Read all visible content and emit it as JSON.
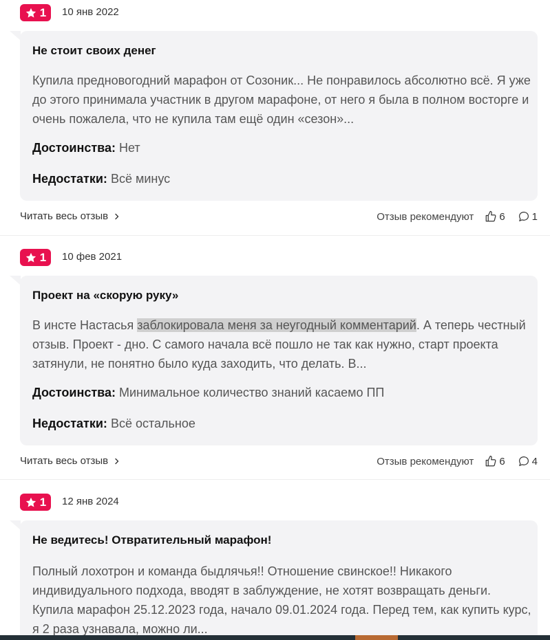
{
  "reviews": [
    {
      "rating": "1",
      "date": "10 янв 2022",
      "title": "Не стоит своих денег",
      "text_before": "Купила предновогодний марафон от Созоник... Не понравилось абсолютно всё. Я уже до этого принимала участник в другом марафоне, от него я была в полном восторге и очень пожалела, что не купила там ещё один «сезон»...",
      "text_highlight": "",
      "text_after": "",
      "pros_label": "Достоинства:",
      "pros": "Нет",
      "cons_label": "Недостатки:",
      "cons": "Всё минус",
      "read_more": "Читать весь отзыв",
      "recommend_label": "Отзыв рекомендуют",
      "likes": "6",
      "comments": "1"
    },
    {
      "rating": "1",
      "date": "10 фев 2021",
      "title": "Проект на «скорую руку»",
      "text_before": "В инсте Настасья ",
      "text_highlight": "заблокировала меня за неугодный комментарий",
      "text_after": ". А теперь честный отзыв. Проект - дно. С самого начала всё пошло не так как нужно, старт проекта затянули, не понятно было куда заходить, что делать. В...",
      "pros_label": "Достоинства:",
      "pros": "Минимальное количество знаний касаемо ПП",
      "cons_label": "Недостатки:",
      "cons": "Всё остальное",
      "read_more": "Читать весь отзыв",
      "recommend_label": "Отзыв рекомендуют",
      "likes": "6",
      "comments": "4"
    },
    {
      "rating": "1",
      "date": "12 янв 2024",
      "title": "Не ведитесь! Отвратительный марафон!",
      "text_before": "Полный лохотрон и команда быдлячья!! Отношение свинское!! Никакого индивидуального подхода, вводят в заблуждение, не хотят возвращать деньги. Купила марафон 25.12.2023 года, начало 09.01.2024 года. Перед тем, как купить курс, я 2 раза узнавала, можно ли...",
      "text_highlight": "",
      "text_after": ""
    }
  ],
  "colors": {
    "rating_badge": "#e8114f",
    "bubble_bg": "#f3f3f5",
    "highlight": "#cfcfcf"
  },
  "icons": {
    "rating": "star-icon",
    "read_more": "chevron-right-icon",
    "likes": "thumbs-up-icon",
    "comments": "comment-icon"
  }
}
